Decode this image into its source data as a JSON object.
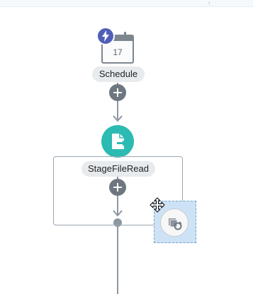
{
  "flow": {
    "schedule": {
      "label": "Schedule",
      "calendar_day": "17"
    },
    "stage_action": {
      "label": "StageFileRead"
    }
  },
  "icons": {
    "trigger_badge": "lightning-bolt-icon",
    "calendar": "calendar-icon",
    "stage_file": "file-export-icon",
    "move_cursor": "move-cursor-icon",
    "dragged_action": "copy-refresh-icon"
  },
  "colors": {
    "accent_teal": "#2bbbb2",
    "badge_purple": "#4f5fb8",
    "connector_gray": "#8d97a1",
    "plus_gray": "#6e7780",
    "drop_zone_blue": "#cde2f5"
  }
}
